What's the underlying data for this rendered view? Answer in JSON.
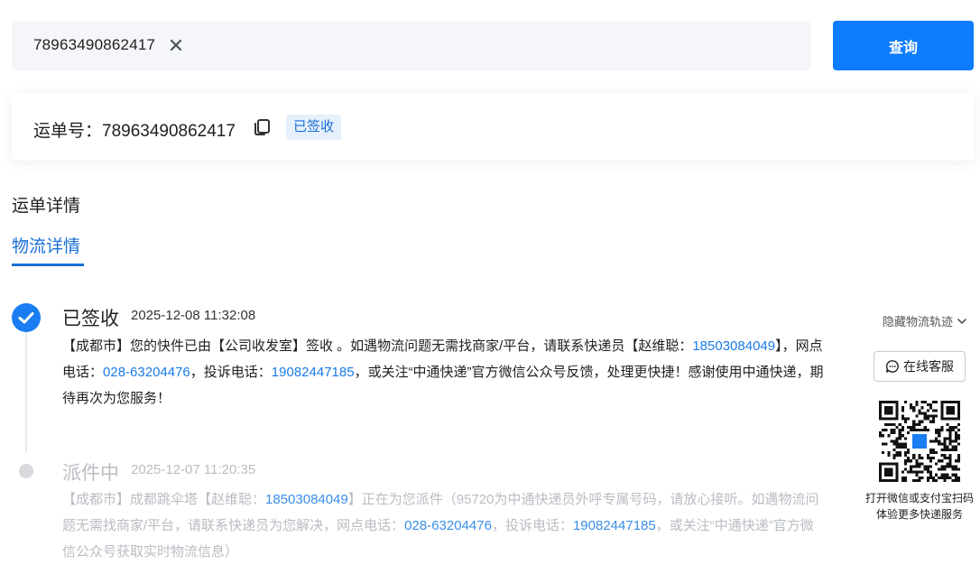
{
  "search": {
    "value": "78963490862417"
  },
  "query_button": {
    "label": "查询"
  },
  "waybill": {
    "label": "运单号：78963490862417",
    "status": "已签收"
  },
  "section_title": "运单详情",
  "tab": {
    "label": "物流详情"
  },
  "events": [
    {
      "status": "已签收",
      "time": "2025-12-08 11:32:08",
      "text1": "【成都市】您的快件已由【公司收发室】签收 。如遇物流问题无需找商家/平台，请联系快递员【赵维聪：",
      "phone_courier": "18503084049",
      "text2": "】，网点电话：",
      "phone_outlet": "028-63204476",
      "text3": "，投诉电话：",
      "phone_complaint": "19082447185",
      "text4": "，或关注“中通快递”官方微信公众号反馈，处理更快捷！感谢使用中通快递，期待再次为您服务！"
    },
    {
      "status": "派件中",
      "time": "2025-12-07 11:20:35",
      "text1": "【成都市】成都跳伞塔【赵维聪：",
      "phone_courier": "18503084049",
      "text2": "】正在为您派件（95720为中通快递员外呼专属号码，请放心接听。如遇物流问题无需找商家/平台，请联系快递员为您解决，网点电话：",
      "phone_outlet": "028-63204476",
      "text3": "，投诉电话：",
      "phone_complaint": "19082447185",
      "text4": "，或关注“中通快递”官方微信公众号获取实时物流信息）"
    }
  ],
  "sidebar": {
    "hide_track": "隐藏物流轨迹",
    "online_service": "在线客服",
    "qr_caption_line1": "打开微信或支付宝扫码",
    "qr_caption_line2": "体验更多快递服务"
  },
  "icons": {
    "clear": "close-icon",
    "copy": "copy-icon",
    "check": "check-icon",
    "chevron": "chevron-down-icon",
    "chat": "chat-bubble-icon",
    "qr": "qr-code-icon"
  },
  "colors": {
    "primary": "#0d7cff",
    "link": "#1a7be8",
    "badge_bg": "#e6f0fc",
    "muted": "#b9bcc2"
  }
}
